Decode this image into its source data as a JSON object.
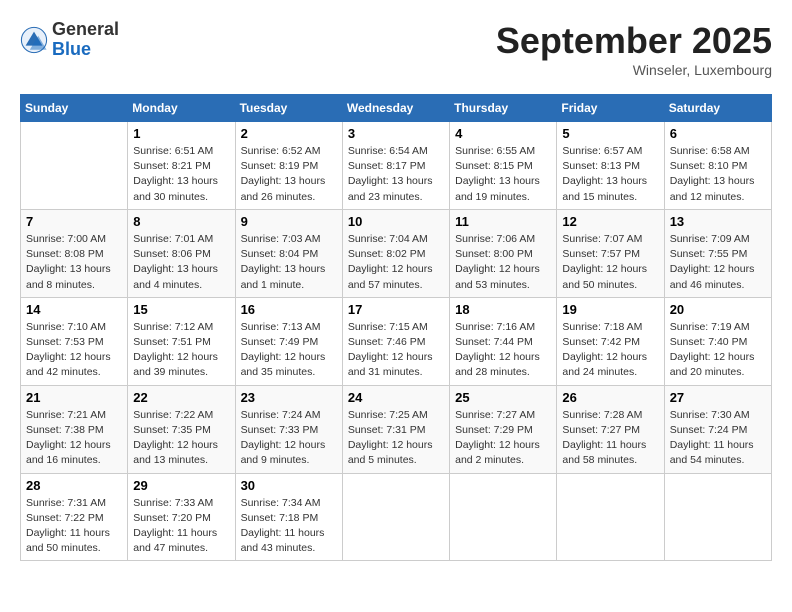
{
  "header": {
    "logo_general": "General",
    "logo_blue": "Blue",
    "month_title": "September 2025",
    "location": "Winseler, Luxembourg"
  },
  "columns": [
    "Sunday",
    "Monday",
    "Tuesday",
    "Wednesday",
    "Thursday",
    "Friday",
    "Saturday"
  ],
  "weeks": [
    [
      {
        "day": "",
        "detail": ""
      },
      {
        "day": "1",
        "detail": "Sunrise: 6:51 AM\nSunset: 8:21 PM\nDaylight: 13 hours\nand 30 minutes."
      },
      {
        "day": "2",
        "detail": "Sunrise: 6:52 AM\nSunset: 8:19 PM\nDaylight: 13 hours\nand 26 minutes."
      },
      {
        "day": "3",
        "detail": "Sunrise: 6:54 AM\nSunset: 8:17 PM\nDaylight: 13 hours\nand 23 minutes."
      },
      {
        "day": "4",
        "detail": "Sunrise: 6:55 AM\nSunset: 8:15 PM\nDaylight: 13 hours\nand 19 minutes."
      },
      {
        "day": "5",
        "detail": "Sunrise: 6:57 AM\nSunset: 8:13 PM\nDaylight: 13 hours\nand 15 minutes."
      },
      {
        "day": "6",
        "detail": "Sunrise: 6:58 AM\nSunset: 8:10 PM\nDaylight: 13 hours\nand 12 minutes."
      }
    ],
    [
      {
        "day": "7",
        "detail": "Sunrise: 7:00 AM\nSunset: 8:08 PM\nDaylight: 13 hours\nand 8 minutes."
      },
      {
        "day": "8",
        "detail": "Sunrise: 7:01 AM\nSunset: 8:06 PM\nDaylight: 13 hours\nand 4 minutes."
      },
      {
        "day": "9",
        "detail": "Sunrise: 7:03 AM\nSunset: 8:04 PM\nDaylight: 13 hours\nand 1 minute."
      },
      {
        "day": "10",
        "detail": "Sunrise: 7:04 AM\nSunset: 8:02 PM\nDaylight: 12 hours\nand 57 minutes."
      },
      {
        "day": "11",
        "detail": "Sunrise: 7:06 AM\nSunset: 8:00 PM\nDaylight: 12 hours\nand 53 minutes."
      },
      {
        "day": "12",
        "detail": "Sunrise: 7:07 AM\nSunset: 7:57 PM\nDaylight: 12 hours\nand 50 minutes."
      },
      {
        "day": "13",
        "detail": "Sunrise: 7:09 AM\nSunset: 7:55 PM\nDaylight: 12 hours\nand 46 minutes."
      }
    ],
    [
      {
        "day": "14",
        "detail": "Sunrise: 7:10 AM\nSunset: 7:53 PM\nDaylight: 12 hours\nand 42 minutes."
      },
      {
        "day": "15",
        "detail": "Sunrise: 7:12 AM\nSunset: 7:51 PM\nDaylight: 12 hours\nand 39 minutes."
      },
      {
        "day": "16",
        "detail": "Sunrise: 7:13 AM\nSunset: 7:49 PM\nDaylight: 12 hours\nand 35 minutes."
      },
      {
        "day": "17",
        "detail": "Sunrise: 7:15 AM\nSunset: 7:46 PM\nDaylight: 12 hours\nand 31 minutes."
      },
      {
        "day": "18",
        "detail": "Sunrise: 7:16 AM\nSunset: 7:44 PM\nDaylight: 12 hours\nand 28 minutes."
      },
      {
        "day": "19",
        "detail": "Sunrise: 7:18 AM\nSunset: 7:42 PM\nDaylight: 12 hours\nand 24 minutes."
      },
      {
        "day": "20",
        "detail": "Sunrise: 7:19 AM\nSunset: 7:40 PM\nDaylight: 12 hours\nand 20 minutes."
      }
    ],
    [
      {
        "day": "21",
        "detail": "Sunrise: 7:21 AM\nSunset: 7:38 PM\nDaylight: 12 hours\nand 16 minutes."
      },
      {
        "day": "22",
        "detail": "Sunrise: 7:22 AM\nSunset: 7:35 PM\nDaylight: 12 hours\nand 13 minutes."
      },
      {
        "day": "23",
        "detail": "Sunrise: 7:24 AM\nSunset: 7:33 PM\nDaylight: 12 hours\nand 9 minutes."
      },
      {
        "day": "24",
        "detail": "Sunrise: 7:25 AM\nSunset: 7:31 PM\nDaylight: 12 hours\nand 5 minutes."
      },
      {
        "day": "25",
        "detail": "Sunrise: 7:27 AM\nSunset: 7:29 PM\nDaylight: 12 hours\nand 2 minutes."
      },
      {
        "day": "26",
        "detail": "Sunrise: 7:28 AM\nSunset: 7:27 PM\nDaylight: 11 hours\nand 58 minutes."
      },
      {
        "day": "27",
        "detail": "Sunrise: 7:30 AM\nSunset: 7:24 PM\nDaylight: 11 hours\nand 54 minutes."
      }
    ],
    [
      {
        "day": "28",
        "detail": "Sunrise: 7:31 AM\nSunset: 7:22 PM\nDaylight: 11 hours\nand 50 minutes."
      },
      {
        "day": "29",
        "detail": "Sunrise: 7:33 AM\nSunset: 7:20 PM\nDaylight: 11 hours\nand 47 minutes."
      },
      {
        "day": "30",
        "detail": "Sunrise: 7:34 AM\nSunset: 7:18 PM\nDaylight: 11 hours\nand 43 minutes."
      },
      {
        "day": "",
        "detail": ""
      },
      {
        "day": "",
        "detail": ""
      },
      {
        "day": "",
        "detail": ""
      },
      {
        "day": "",
        "detail": ""
      }
    ]
  ]
}
